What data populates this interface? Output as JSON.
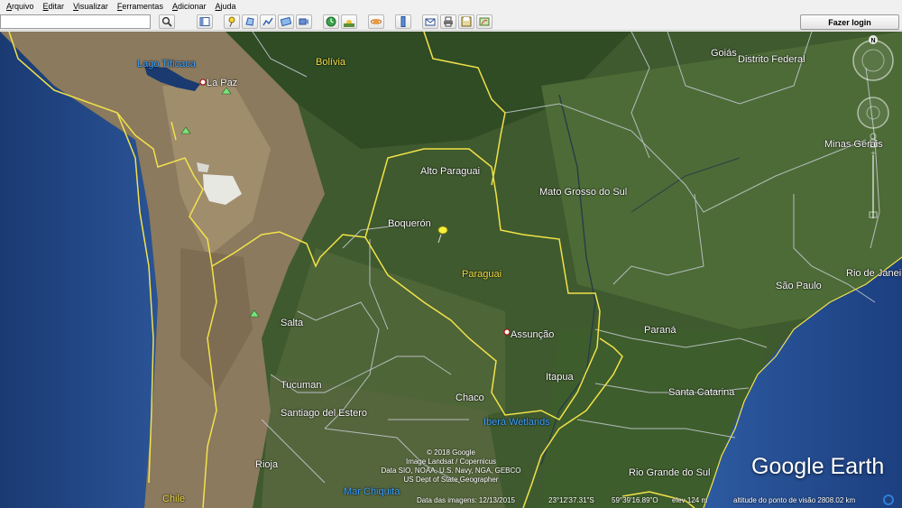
{
  "menu": [
    "Arquivo",
    "Editar",
    "Visualizar",
    "Ferramentas",
    "Adicionar",
    "Ajuda"
  ],
  "search": {
    "value": "",
    "placeholder": ""
  },
  "toolbar": {
    "login_label": "Fazer login"
  },
  "labels": {
    "lago_titicaca": "Lago Titicaca",
    "la_paz": "La Paz",
    "bolivia": "Bolívia",
    "goias": "Goiás",
    "distrito_federal": "Distrito Federal",
    "minas_gerais": "Minas Gerais",
    "alto_paraguai": "Alto Paraguai",
    "mato_grosso_do_sul": "Mato Grosso do Sul",
    "boqueron": "Boquerón",
    "paraguai": "Paraguai",
    "rio_de_janeiro": "Rio de Janei",
    "sao_paulo": "São Paulo",
    "salta": "Salta",
    "assuncao": "Assunção",
    "parana": "Paraná",
    "itapua": "Itapua",
    "tucuman": "Tucuman",
    "chaco": "Chaco",
    "santa_catarina": "Santa Catarina",
    "santiago_del_estero": "Santiago del Estero",
    "ibera_wetlands": "Iberá Wetlands",
    "rio_grande_do_sul": "Rio Grande do Sul",
    "rioja": "Rioja",
    "mar_chiquita": "Mar Chiquita",
    "chile": "Chile"
  },
  "copyright_lines": [
    "© 2018 Google",
    "Image Landsat / Copernicus",
    "Data SIO, NOAA, U.S. Navy, NGA, GEBCO",
    "US Dept of State Geographer"
  ],
  "status": {
    "imagery_date": "Data das imagens: 12/13/2015",
    "lat": "23°12'37.31\"S",
    "lon": "59°39'16.89\"O",
    "elev": "elev   124 m",
    "eye_alt": "altitude do ponto de visão 2808.02 km"
  },
  "logo": "Google Earth",
  "compass_north": "N",
  "colors": {
    "border_country": "#f2e24a",
    "border_state": "#c8ccd6",
    "ocean": "#1d3f7a",
    "land_green": "#3d5a2c",
    "andes": "#8a7a62"
  }
}
